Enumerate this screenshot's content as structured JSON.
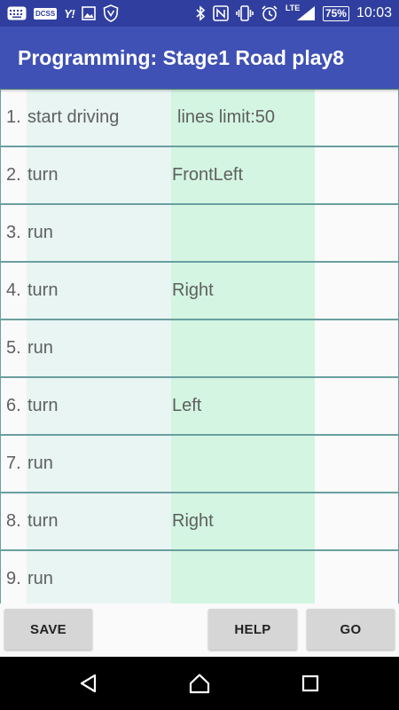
{
  "status_bar": {
    "left_icons": [
      "notification-grid-icon",
      "docss-icon",
      "yahoo-icon",
      "image-icon",
      "shield-icon"
    ],
    "docss_label": "DCSS",
    "yahoo_label": "Y!",
    "right_icons": [
      "bluetooth-icon",
      "nfc-icon",
      "vibrate-icon",
      "alarm-icon",
      "lte-signal-icon",
      "battery-icon"
    ],
    "lte_label": "LTE",
    "battery": "75%",
    "time": "10:03"
  },
  "app_bar": {
    "title": "Programming: Stage1 Road play8"
  },
  "program": {
    "lines_limit": "lines limit:50",
    "rows": [
      {
        "num": "1.",
        "command": "start driving",
        "param": ""
      },
      {
        "num": "2.",
        "command": "turn",
        "param": "FrontLeft"
      },
      {
        "num": "3.",
        "command": "run",
        "param": ""
      },
      {
        "num": "4.",
        "command": "turn",
        "param": "Right"
      },
      {
        "num": "5.",
        "command": "run",
        "param": ""
      },
      {
        "num": "6.",
        "command": "turn",
        "param": "Left"
      },
      {
        "num": "7.",
        "command": "run",
        "param": ""
      },
      {
        "num": "8.",
        "command": "turn",
        "param": "Right"
      },
      {
        "num": "9.",
        "command": "run",
        "param": ""
      }
    ]
  },
  "buttons": {
    "save": "SAVE",
    "help": "HELP",
    "go": "GO"
  },
  "colors": {
    "status_bar": "#303f9f",
    "app_bar": "#3f51b5",
    "command_column": "#e8f5f3",
    "param_column": "#d3f5e1",
    "row_border": "#6a9f9f",
    "button": "#d6d6d6"
  }
}
